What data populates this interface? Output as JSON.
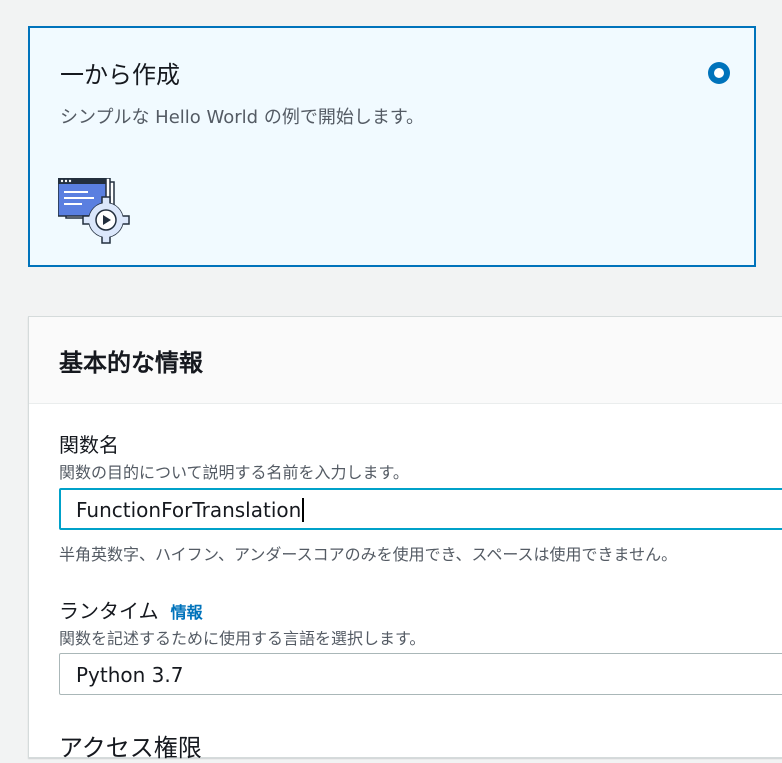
{
  "option_card": {
    "title": "一から作成",
    "description": "シンプルな Hello World の例で開始します。",
    "icon": "code-window-gear-icon",
    "selected": true
  },
  "basic_info": {
    "title": "基本的な情報",
    "function_name": {
      "label": "関数名",
      "description": "関数の目的について説明する名前を入力します。",
      "value": "FunctionForTranslation",
      "hint": "半角英数字、ハイフン、アンダースコアのみを使用でき、スペースは使用できません。"
    },
    "runtime": {
      "label": "ランタイム",
      "info_link": "情報",
      "description": "関数を記述するために使用する言語を選択します。",
      "value": "Python 3.7"
    },
    "next_section_label": "アクセス権限"
  },
  "colors": {
    "accent": "#0073bb",
    "focus": "#00a1c9",
    "card_bg": "#f1faff"
  }
}
